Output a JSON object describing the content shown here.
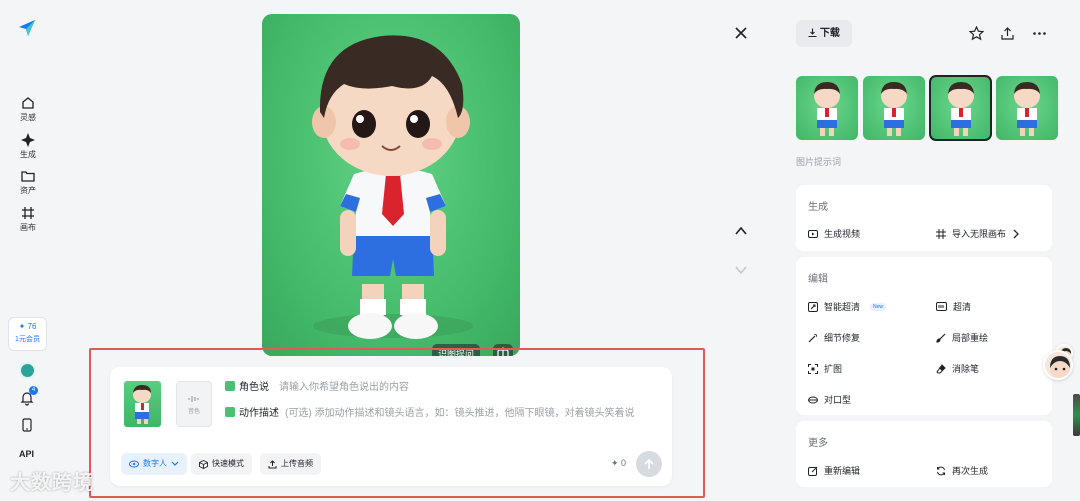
{
  "sidebar": {
    "items": [
      {
        "label": "灵感",
        "icon": "home-icon"
      },
      {
        "label": "生成",
        "icon": "sparkle-icon"
      },
      {
        "label": "资产",
        "icon": "folder-icon"
      },
      {
        "label": "画布",
        "icon": "canvas-grid-icon"
      }
    ],
    "points": "✦ 76",
    "membership": "1元会员",
    "notification_count": "4",
    "api_label": "API"
  },
  "viewer": {
    "image_buttons": [
      "识图提问"
    ],
    "image_description": "3D cartoon boy in white shirt with red tie and blue shorts on green background"
  },
  "prompt": {
    "audio_label": "音色",
    "role_tag": "角色说",
    "role_placeholder": "请输入你希望角色说出的内容",
    "action_tag": "动作描述",
    "action_placeholder": "(可选) 添加动作描述和镜头语言，如：镜头推进，他隔下眼镜，对着镜头笑着说",
    "chips": [
      "数字人",
      "快速模式",
      "上传音频"
    ],
    "cost": "✦ 0"
  },
  "right_panel": {
    "download_label": "下载",
    "prompt_section_label": "图片提示词",
    "generate": {
      "title": "生成",
      "actions": [
        "生成视频",
        "导入无限画布"
      ]
    },
    "edit": {
      "title": "编辑",
      "actions": [
        "智能超清",
        "超清",
        "细节修复",
        "局部重绘",
        "扩图",
        "消除笔",
        "对口型"
      ],
      "new_badge": "New"
    },
    "more": {
      "title": "更多",
      "actions": [
        "重新编辑",
        "再次生成"
      ]
    }
  },
  "watermark": "大数跨境",
  "colors": {
    "accent": "#1677ff",
    "image_bg": "#4cc472",
    "highlight_frame": "#e05a5a"
  }
}
